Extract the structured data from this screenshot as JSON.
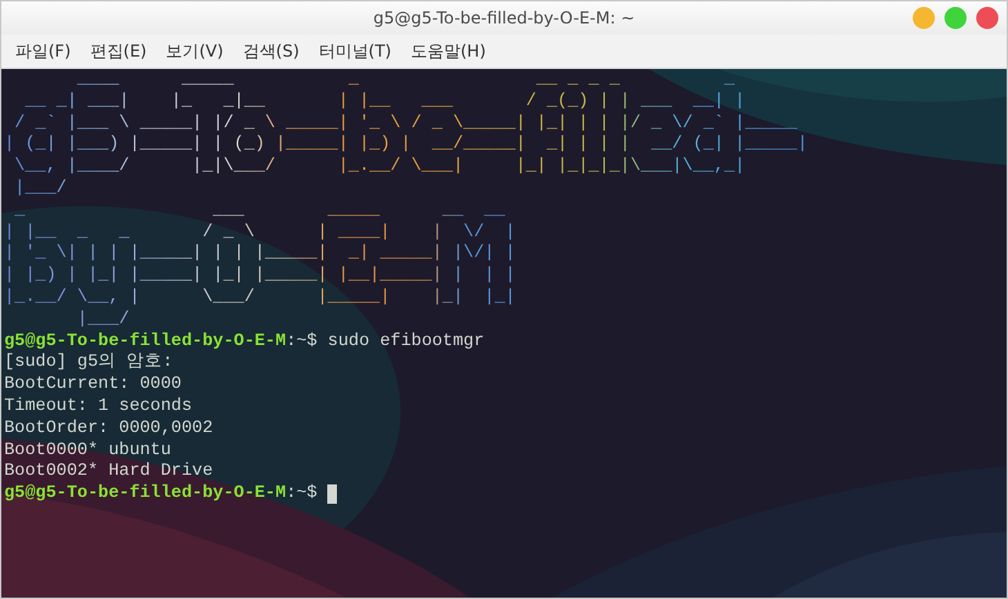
{
  "window": {
    "title": "g5@g5-To-be-filled-by-O-E-M: ~"
  },
  "menu": [
    {
      "label": "파일(F)"
    },
    {
      "label": "편집(E)"
    },
    {
      "label": "보기(V)"
    },
    {
      "label": "검색(S)"
    },
    {
      "label": "터미널(T)"
    },
    {
      "label": "도움말(H)"
    }
  ],
  "terminal": {
    "banner": [
      {
        "text": "       ____      _____           _                 __ _ _ _          _\n  __ _| ___|    |_   _|__       | |__   ___       / _(_) | | ___  __| |\n / _` |___ \\ _____| |/ _ \\ _____| '_ \\ / _ \\_____| |_| | | |/ _ \\/ _` |_____\n| (_| |___) |_____| | (_) |_____| |_) |  __/_____|  _| | | |  __/ (_| |_____|\n \\__, |____/      |_|\\___/      |_.__/ \\___|     |_| |_|_|_|\\___|\\__,_|\n |___/"
      },
      {
        "text": " _                  ___        _____      __  __\n| |__  _   _       / _ \\      | ____|    |  \\/  |\n| '_ \\| | | |_____| | | |_____|  _| _____| |\\/| |\n| |_) | |_| |_____| |_| |_____| |__|_____| |  | |\n|_.__/ \\__, |      \\___/      |_____|    |_|  |_|\n       |___/"
      }
    ],
    "lines": [
      {
        "kind": "prompt",
        "user_host": "g5@g5-To-be-filled-by-O-E-M",
        "path": ":~$",
        "command": "sudo efibootmgr",
        "cursor": false
      },
      {
        "kind": "output",
        "text": "[sudo] g5의 암호:"
      },
      {
        "kind": "output",
        "text": "BootCurrent: 0000"
      },
      {
        "kind": "output",
        "text": "Timeout: 1 seconds"
      },
      {
        "kind": "output",
        "text": "BootOrder: 0000,0002"
      },
      {
        "kind": "output",
        "text": "Boot0000* ubuntu"
      },
      {
        "kind": "output",
        "text": "Boot0002* Hard Drive"
      },
      {
        "kind": "prompt",
        "user_host": "g5@g5-To-be-filled-by-O-E-M",
        "path": ":~$",
        "cursor": true
      }
    ]
  }
}
